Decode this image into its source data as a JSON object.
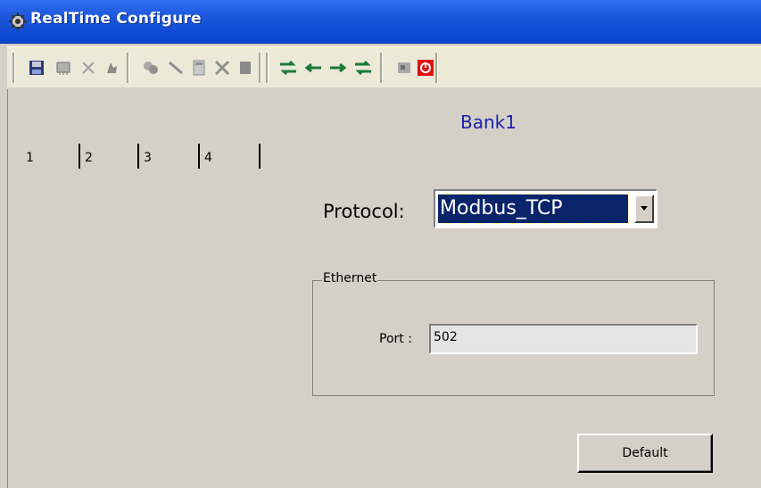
{
  "window": {
    "title": "RealTime Configure"
  },
  "toolbar": {
    "icons": [
      "save-icon",
      "memory-icon",
      "delete-icon",
      "pointer-icon",
      "tags-icon",
      "line-icon",
      "calculator-icon",
      "tools-icon",
      "block-icon",
      "sync-icon",
      "arrow-left-icon",
      "arrow-right-icon",
      "swap-icon",
      "export-icon",
      "power-icon"
    ]
  },
  "bank": {
    "title": "Bank1"
  },
  "tabs": [
    {
      "label": "1"
    },
    {
      "label": "2"
    },
    {
      "label": "3"
    },
    {
      "label": "4"
    }
  ],
  "protocol": {
    "label": "Protocol:",
    "value": "Modbus_TCP"
  },
  "ethernet": {
    "legend": "Ethernet",
    "port_label": "Port :",
    "port_value": "502"
  },
  "buttons": {
    "default_label": "Default"
  },
  "colors": {
    "title_bar": "#1c56dc",
    "bank_title": "#2020b0",
    "selection": "#0a246a",
    "toolbar_icon_green": "#1a7a3a",
    "power_red": "#e01010"
  }
}
